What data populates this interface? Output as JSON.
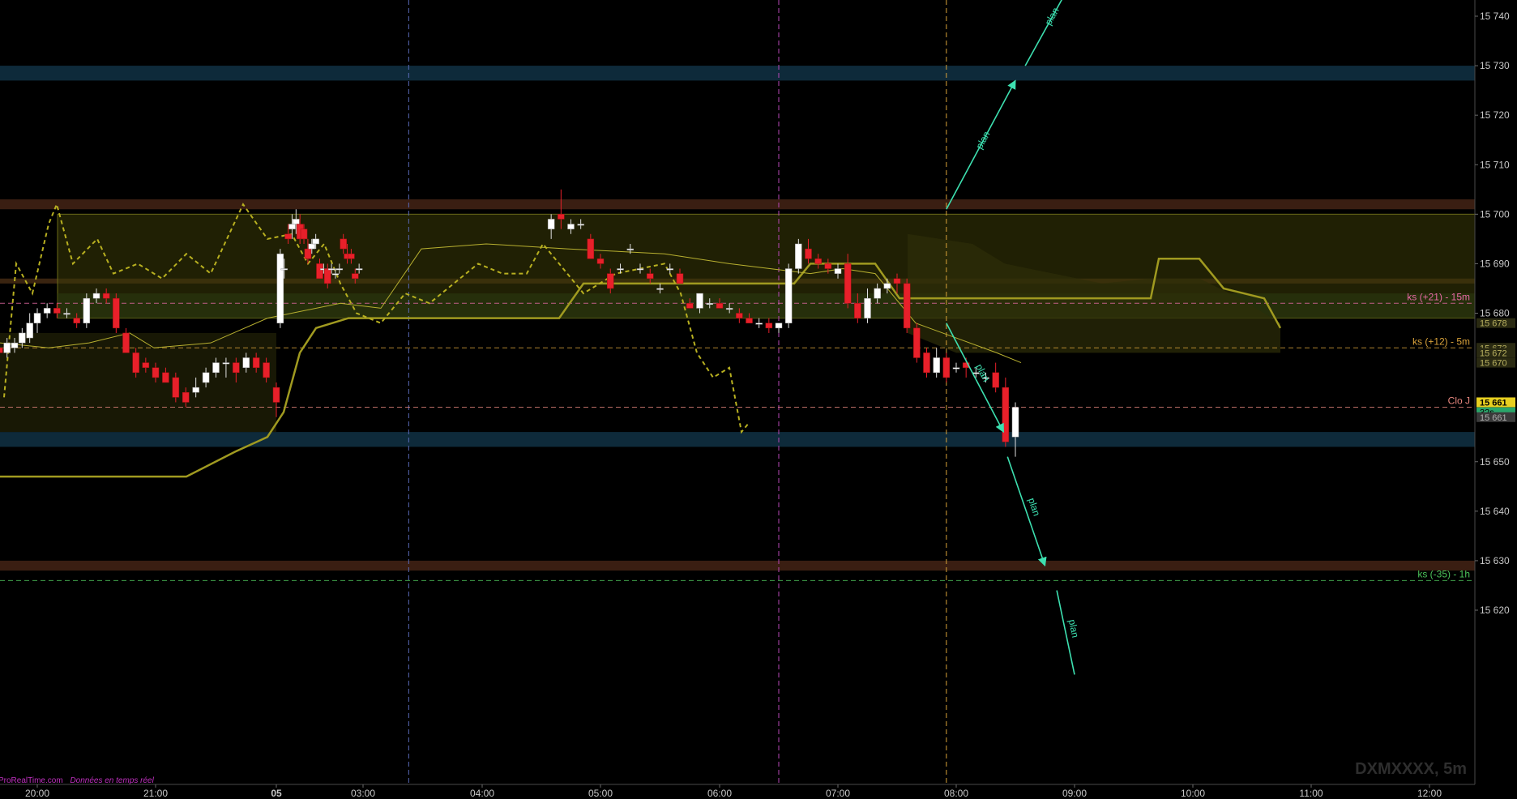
{
  "chart_data": {
    "type": "candlestick",
    "symbol": "DXMXXXX, 5m",
    "source": "ProRealTime.com",
    "source_note": "Données en temps réel",
    "y_ticks": [
      "15 740",
      "15 730",
      "15 720",
      "15 710",
      "15 700",
      "15 690",
      "15 680",
      "15 650",
      "15 640",
      "15 630",
      "15 620"
    ],
    "x_ticks": [
      "20:00",
      "21:00",
      "05",
      "03:00",
      "04:00",
      "05:00",
      "06:00",
      "07:00",
      "08:00",
      "09:00",
      "10:00",
      "11:00",
      "12:00"
    ],
    "levels": [
      {
        "label": "ks (+21) - 15m",
        "price": 15682,
        "color": "#e86aa6"
      },
      {
        "label": "ks (+12) - 5m",
        "price": 15673,
        "color": "#d9a23a"
      },
      {
        "label": "Clo J",
        "price": 15661,
        "color": "#e8877e"
      },
      {
        "label": "ks (-35) - 1h",
        "price": 15626,
        "color": "#4cc35a"
      }
    ],
    "price_badges": [
      {
        "text": "15 678",
        "price": 15678,
        "bg": "#2a2a12",
        "fg": "#b8b060"
      },
      {
        "text": "15 673",
        "price": 15673,
        "bg": "#2a2a12",
        "fg": "#b8b060"
      },
      {
        "text": "15 672",
        "price": 15672,
        "bg": "#2a2a12",
        "fg": "#b8b060"
      },
      {
        "text": "15 670",
        "price": 15670,
        "bg": "#2a2a12",
        "fg": "#b8b060"
      },
      {
        "text": "15 661",
        "price": 15662,
        "bg": "#e8d020",
        "fg": "#000000"
      },
      {
        "text": "32s",
        "price": 15660,
        "bg": "#2aa56a",
        "fg": "#000000"
      },
      {
        "text": "15 661",
        "price": 15659,
        "bg": "#3a3a3a",
        "fg": "#b0b0b0"
      }
    ],
    "zones": [
      {
        "from": 15727,
        "to": 15730,
        "color": "#0e2a3a"
      },
      {
        "from": 15701,
        "to": 15703,
        "color": "#3a1e12"
      },
      {
        "from": 15686,
        "to": 15687,
        "color": "#3a2410"
      },
      {
        "from": 15653,
        "to": 15656,
        "color": "#0e2a3a"
      },
      {
        "from": 15628,
        "to": 15630,
        "color": "#3a1e12"
      }
    ],
    "sessions": [
      {
        "time": "03:23",
        "color": "#5a6ab8"
      },
      {
        "time": "06:30",
        "color": "#b847b8"
      },
      {
        "time": "07:55",
        "color": "#d9a23a"
      }
    ],
    "plan_label": "plan",
    "plan_arrows": [
      {
        "from": [
          "07:55",
          15701
        ],
        "to": [
          "08:30",
          15727
        ],
        "label": true,
        "arrow": true
      },
      {
        "from": [
          "08:35",
          15730
        ],
        "to": [
          "09:00",
          15748
        ],
        "label": true,
        "arrow": false
      },
      {
        "from": [
          "07:55",
          15678
        ],
        "to": [
          "08:24",
          15656
        ],
        "label": true,
        "arrow": true
      },
      {
        "from": [
          "08:26",
          15651
        ],
        "to": [
          "08:45",
          15629
        ],
        "label": true,
        "arrow": true
      },
      {
        "from": [
          "08:51",
          15624
        ],
        "to": [
          "09:00",
          15607
        ],
        "label": true,
        "arrow": false
      }
    ],
    "candles": [
      {
        "t": "19:35",
        "o": 15673,
        "h": 15674,
        "l": 15670,
        "c": 15672
      },
      {
        "t": "19:40",
        "o": 15672,
        "h": 15675,
        "l": 15671,
        "c": 15674
      },
      {
        "t": "19:45",
        "o": 15673,
        "h": 15675,
        "l": 15672,
        "c": 15674
      },
      {
        "t": "19:50",
        "o": 15674,
        "h": 15677,
        "l": 15673,
        "c": 15676
      },
      {
        "t": "19:55",
        "o": 15675,
        "h": 15680,
        "l": 15674,
        "c": 15678
      },
      {
        "t": "20:00",
        "o": 15678,
        "h": 15681,
        "l": 15676,
        "c": 15680
      },
      {
        "t": "20:05",
        "o": 15680,
        "h": 15682,
        "l": 15679,
        "c": 15681
      },
      {
        "t": "20:10",
        "o": 15681,
        "h": 15682,
        "l": 15679,
        "c": 15680
      },
      {
        "t": "20:15",
        "o": 15680,
        "h": 15681,
        "l": 15679,
        "c": 15680
      },
      {
        "t": "20:20",
        "o": 15679,
        "h": 15680,
        "l": 15677,
        "c": 15678
      },
      {
        "t": "20:25",
        "o": 15678,
        "h": 15684,
        "l": 15677,
        "c": 15683
      },
      {
        "t": "20:30",
        "o": 15683,
        "h": 15685,
        "l": 15682,
        "c": 15684
      },
      {
        "t": "20:35",
        "o": 15684,
        "h": 15685,
        "l": 15682,
        "c": 15683
      },
      {
        "t": "20:40",
        "o": 15683,
        "h": 15684,
        "l": 15676,
        "c": 15677
      },
      {
        "t": "20:45",
        "o": 15676,
        "h": 15677,
        "l": 15672,
        "c": 15672
      },
      {
        "t": "20:50",
        "o": 15672,
        "h": 15673,
        "l": 15667,
        "c": 15668
      },
      {
        "t": "20:55",
        "o": 15670,
        "h": 15671,
        "l": 15668,
        "c": 15669
      },
      {
        "t": "21:00",
        "o": 15669,
        "h": 15670,
        "l": 15666,
        "c": 15667
      },
      {
        "t": "21:05",
        "o": 15668,
        "h": 15669,
        "l": 15666,
        "c": 15666
      },
      {
        "t": "21:10",
        "o": 15667,
        "h": 15668,
        "l": 15662,
        "c": 15663
      },
      {
        "t": "21:15",
        "o": 15664,
        "h": 15665,
        "l": 15661,
        "c": 15662
      },
      {
        "t": "21:20",
        "o": 15664,
        "h": 15667,
        "l": 15663,
        "c": 15665
      },
      {
        "t": "21:25",
        "o": 15666,
        "h": 15669,
        "l": 15665,
        "c": 15668
      },
      {
        "t": "21:30",
        "o": 15668,
        "h": 15671,
        "l": 15667,
        "c": 15670
      },
      {
        "t": "21:35",
        "o": 15670,
        "h": 15671,
        "l": 15667,
        "c": 15670
      },
      {
        "t": "21:40",
        "o": 15670,
        "h": 15671,
        "l": 15666,
        "c": 15668
      },
      {
        "t": "21:45",
        "o": 15669,
        "h": 15672,
        "l": 15668,
        "c": 15671
      },
      {
        "t": "21:50",
        "o": 15671,
        "h": 15672,
        "l": 15668,
        "c": 15669
      },
      {
        "t": "21:55",
        "o": 15670,
        "h": 15671,
        "l": 15666,
        "c": 15667
      },
      {
        "t": "22:00",
        "o": 15665,
        "h": 15666,
        "l": 15659,
        "c": 15662
      },
      {
        "t": "22:05",
        "o": 15678,
        "h": 15693,
        "l": 15677,
        "c": 15692
      },
      {
        "t": "22:10",
        "o": 15689,
        "h": 15691,
        "l": 15687,
        "c": 15689
      },
      {
        "t": "22:15",
        "o": 15696,
        "h": 15698,
        "l": 15694,
        "c": 15695
      },
      {
        "t": "22:20",
        "o": 15697,
        "h": 15700,
        "l": 15695,
        "c": 15698
      },
      {
        "t": "22:25",
        "o": 15698,
        "h": 15701,
        "l": 15696,
        "c": 15699
      },
      {
        "t": "22:30",
        "o": 15698,
        "h": 15700,
        "l": 15694,
        "c": 15695
      },
      {
        "t": "22:35",
        "o": 15697,
        "h": 15698,
        "l": 15694,
        "c": 15695
      },
      {
        "t": "22:40",
        "o": 15693,
        "h": 15695,
        "l": 15690,
        "c": 15691
      },
      {
        "t": "22:45",
        "o": 15693,
        "h": 15695,
        "l": 15692,
        "c": 15694
      },
      {
        "t": "22:50",
        "o": 15694,
        "h": 15696,
        "l": 15693,
        "c": 15695
      },
      {
        "t": "22:55",
        "o": 15690,
        "h": 15691,
        "l": 15687,
        "c": 15687
      },
      {
        "t": "23:00",
        "o": 15689,
        "h": 15690,
        "l": 15688,
        "c": 15689
      },
      {
        "t": "23:05",
        "o": 15689,
        "h": 15690,
        "l": 15685,
        "c": 15686
      },
      {
        "t": "23:10",
        "o": 15689,
        "h": 15690,
        "l": 15688,
        "c": 15689
      },
      {
        "t": "23:15",
        "o": 15688,
        "h": 15689,
        "l": 15687,
        "c": 15688
      },
      {
        "t": "23:20",
        "o": 15689,
        "h": 15690,
        "l": 15688,
        "c": 15689
      },
      {
        "t": "23:25",
        "o": 15695,
        "h": 15696,
        "l": 15692,
        "c": 15693
      },
      {
        "t": "23:30",
        "o": 15692,
        "h": 15694,
        "l": 15690,
        "c": 15691
      },
      {
        "t": "23:35",
        "o": 15692,
        "h": 15693,
        "l": 15690,
        "c": 15691
      },
      {
        "t": "23:40",
        "o": 15688,
        "h": 15689,
        "l": 15686,
        "c": 15687
      },
      {
        "t": "23:45",
        "o": 15689,
        "h": 15690,
        "l": 15688,
        "c": 15689
      },
      {
        "t": "04:35",
        "o": 15697,
        "h": 15700,
        "l": 15695,
        "c": 15699
      },
      {
        "t": "04:40",
        "o": 15700,
        "h": 15705,
        "l": 15697,
        "c": 15699
      },
      {
        "t": "04:45",
        "o": 15697,
        "h": 15699,
        "l": 15696,
        "c": 15698
      },
      {
        "t": "04:50",
        "o": 15698,
        "h": 15699,
        "l": 15697,
        "c": 15698
      },
      {
        "t": "04:55",
        "o": 15695,
        "h": 15696,
        "l": 15691,
        "c": 15691
      },
      {
        "t": "05:00",
        "o": 15691,
        "h": 15692,
        "l": 15689,
        "c": 15690
      },
      {
        "t": "05:05",
        "o": 15688,
        "h": 15689,
        "l": 15684,
        "c": 15685
      },
      {
        "t": "05:10",
        "o": 15689,
        "h": 15690,
        "l": 15688,
        "c": 15689
      },
      {
        "t": "05:15",
        "o": 15693,
        "h": 15694,
        "l": 15692,
        "c": 15693
      },
      {
        "t": "05:20",
        "o": 15689,
        "h": 15690,
        "l": 15688,
        "c": 15689
      },
      {
        "t": "05:25",
        "o": 15688,
        "h": 15689,
        "l": 15686,
        "c": 15687
      },
      {
        "t": "05:30",
        "o": 15685,
        "h": 15686,
        "l": 15684,
        "c": 15685
      },
      {
        "t": "05:35",
        "o": 15689,
        "h": 15690,
        "l": 15688,
        "c": 15689
      },
      {
        "t": "05:40",
        "o": 15688,
        "h": 15689,
        "l": 15686,
        "c": 15686
      },
      {
        "t": "05:45",
        "o": 15682,
        "h": 15683,
        "l": 15681,
        "c": 15681
      },
      {
        "t": "05:50",
        "o": 15681,
        "h": 15684,
        "l": 15680,
        "c": 15684
      },
      {
        "t": "05:55",
        "o": 15682,
        "h": 15683,
        "l": 15681,
        "c": 15682
      },
      {
        "t": "06:00",
        "o": 15682,
        "h": 15683,
        "l": 15681,
        "c": 15681
      },
      {
        "t": "06:05",
        "o": 15681,
        "h": 15682,
        "l": 15680,
        "c": 15681
      },
      {
        "t": "06:10",
        "o": 15680,
        "h": 15681,
        "l": 15678,
        "c": 15679
      },
      {
        "t": "06:15",
        "o": 15679,
        "h": 15680,
        "l": 15678,
        "c": 15678
      },
      {
        "t": "06:20",
        "o": 15678,
        "h": 15679,
        "l": 15677,
        "c": 15678
      },
      {
        "t": "06:25",
        "o": 15678,
        "h": 15679,
        "l": 15676,
        "c": 15677
      },
      {
        "t": "06:30",
        "o": 15677,
        "h": 15678,
        "l": 15676,
        "c": 15678
      },
      {
        "t": "06:35",
        "o": 15678,
        "h": 15690,
        "l": 15677,
        "c": 15689
      },
      {
        "t": "06:40",
        "o": 15689,
        "h": 15695,
        "l": 15688,
        "c": 15694
      },
      {
        "t": "06:45",
        "o": 15693,
        "h": 15695,
        "l": 15690,
        "c": 15691
      },
      {
        "t": "06:50",
        "o": 15691,
        "h": 15692,
        "l": 15689,
        "c": 15690
      },
      {
        "t": "06:55",
        "o": 15690,
        "h": 15691,
        "l": 15688,
        "c": 15689
      },
      {
        "t": "07:00",
        "o": 15688,
        "h": 15690,
        "l": 15687,
        "c": 15689
      },
      {
        "t": "07:05",
        "o": 15690,
        "h": 15692,
        "l": 15681,
        "c": 15682
      },
      {
        "t": "07:10",
        "o": 15682,
        "h": 15684,
        "l": 15678,
        "c": 15679
      },
      {
        "t": "07:15",
        "o": 15679,
        "h": 15685,
        "l": 15678,
        "c": 15683
      },
      {
        "t": "07:20",
        "o": 15683,
        "h": 15686,
        "l": 15682,
        "c": 15685
      },
      {
        "t": "07:25",
        "o": 15685,
        "h": 15687,
        "l": 15684,
        "c": 15686
      },
      {
        "t": "07:30",
        "o": 15687,
        "h": 15688,
        "l": 15684,
        "c": 15686
      },
      {
        "t": "07:35",
        "o": 15686,
        "h": 15687,
        "l": 15676,
        "c": 15677
      },
      {
        "t": "07:40",
        "o": 15677,
        "h": 15678,
        "l": 15670,
        "c": 15671
      },
      {
        "t": "07:45",
        "o": 15672,
        "h": 15673,
        "l": 15667,
        "c": 15668
      },
      {
        "t": "07:50",
        "o": 15668,
        "h": 15673,
        "l": 15667,
        "c": 15671
      },
      {
        "t": "07:55",
        "o": 15671,
        "h": 15672,
        "l": 15666,
        "c": 15667
      },
      {
        "t": "08:00",
        "o": 15669,
        "h": 15670,
        "l": 15668,
        "c": 15669
      },
      {
        "t": "08:05",
        "o": 15670,
        "h": 15671,
        "l": 15667,
        "c": 15669
      },
      {
        "t": "08:10",
        "o": 15668,
        "h": 15669,
        "l": 15667,
        "c": 15668
      },
      {
        "t": "08:15",
        "o": 15667,
        "h": 15668,
        "l": 15666,
        "c": 15667
      },
      {
        "t": "08:20",
        "o": 15668,
        "h": 15670,
        "l": 15664,
        "c": 15665
      },
      {
        "t": "08:25",
        "o": 15665,
        "h": 15667,
        "l": 15653,
        "c": 15654
      },
      {
        "t": "08:30",
        "o": 15655,
        "h": 15662,
        "l": 15651,
        "c": 15661
      }
    ]
  }
}
